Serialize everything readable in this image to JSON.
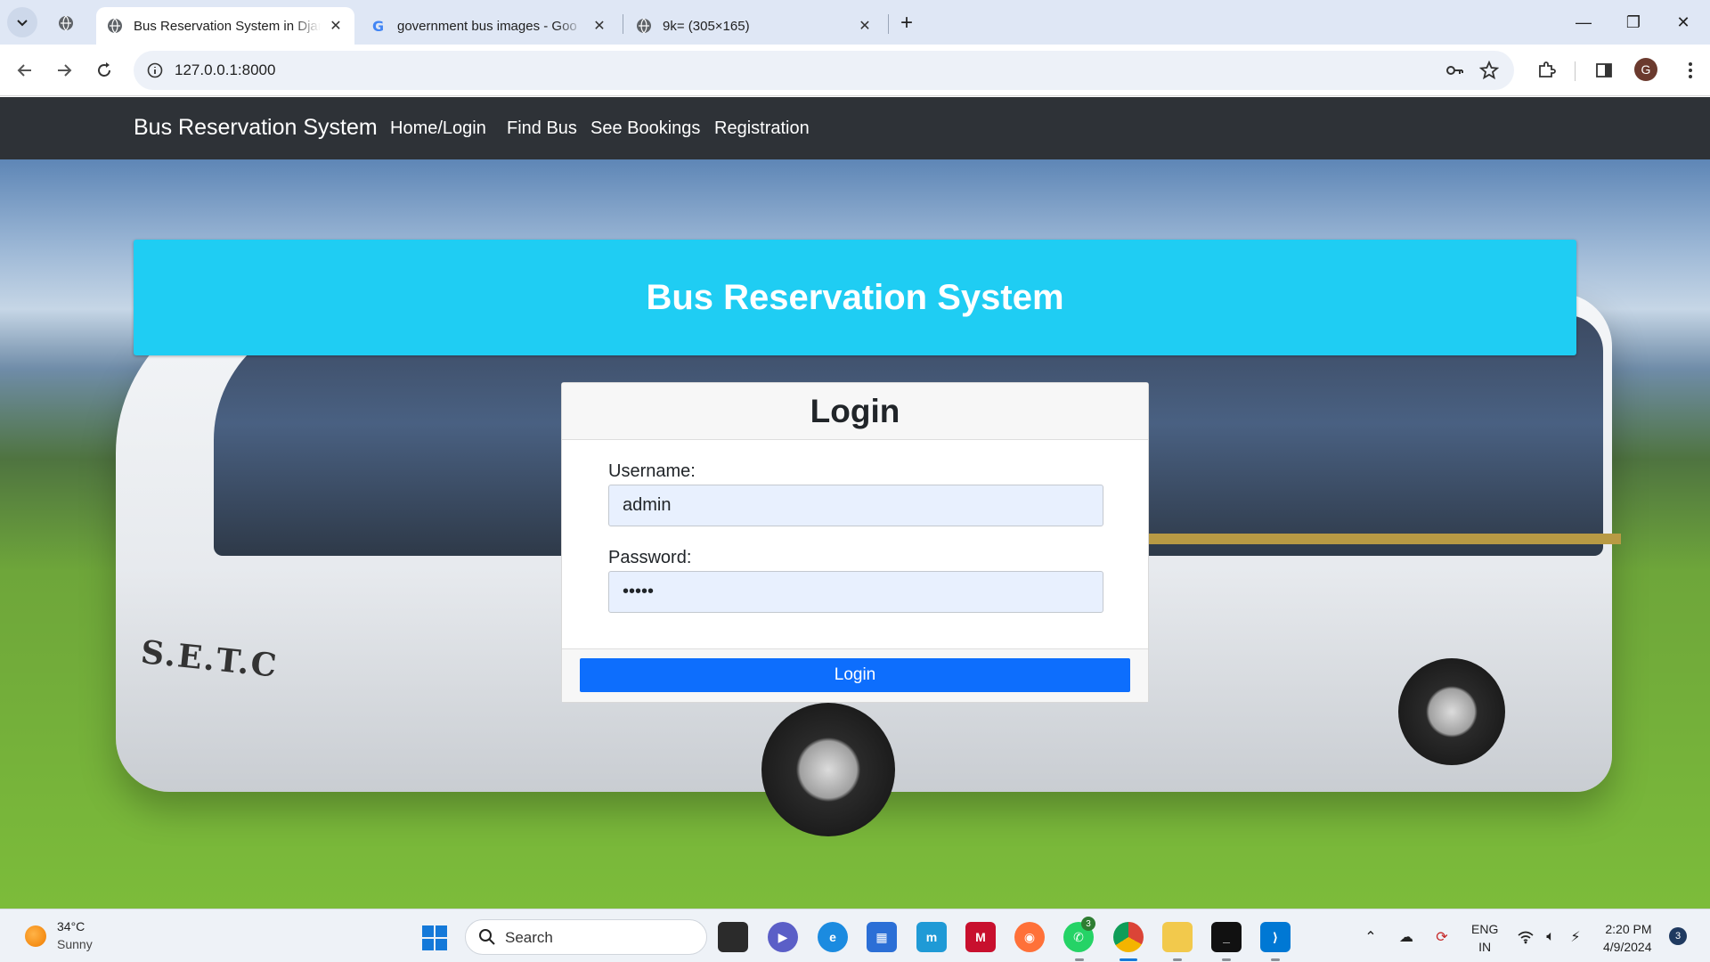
{
  "browser": {
    "tabs": [
      {
        "title": "Bus Reservation System in Djan",
        "active": true,
        "favicon": "globe-icon"
      },
      {
        "title": "government bus images - Goo",
        "active": false,
        "favicon": "google-icon"
      },
      {
        "title": "9k= (305×165)",
        "active": false,
        "favicon": "globe-icon"
      }
    ],
    "url": "127.0.0.1:8000",
    "profile_initial": "G"
  },
  "site": {
    "brand": "Bus Reservation System",
    "nav": [
      "Home/Login",
      "Find Bus",
      "See Bookings",
      "Registration"
    ],
    "banner_title": "Bus Reservation System",
    "bus_text": "S.E.T.C"
  },
  "login": {
    "title": "Login",
    "username_label": "Username:",
    "username_value": "admin",
    "password_label": "Password:",
    "password_value": "•••••",
    "button": "Login"
  },
  "taskbar": {
    "weather_temp": "34°C",
    "weather_desc": "Sunny",
    "search_placeholder": "Search",
    "whatsapp_badge": "3",
    "lang_top": "ENG",
    "lang_bottom": "IN",
    "time": "2:20 PM",
    "date": "4/9/2024",
    "notification_count": "3"
  },
  "colors": {
    "navbar": "#2e3237",
    "banner": "#1fcdf3",
    "primary_button": "#0d6efd",
    "input_autofill": "#e8f0fe"
  }
}
